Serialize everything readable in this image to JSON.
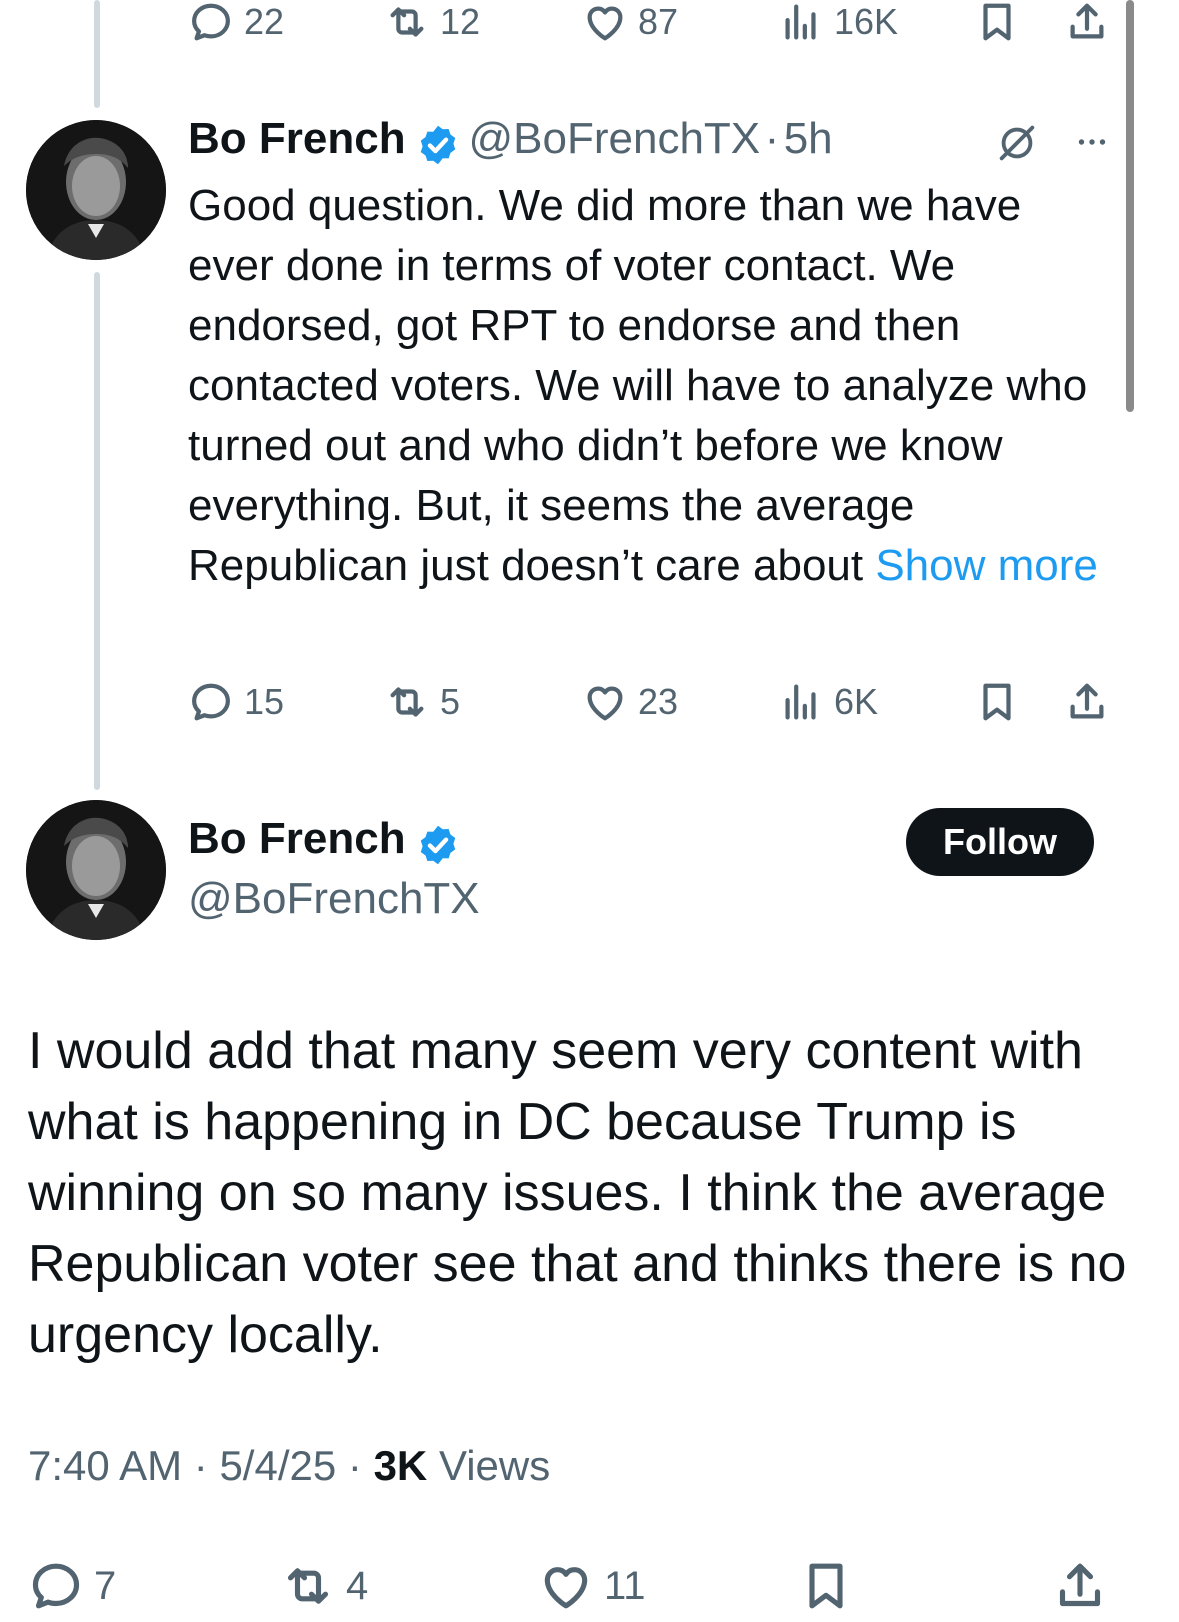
{
  "top_actions": {
    "replies": "22",
    "reposts": "12",
    "likes": "87",
    "views": "16K"
  },
  "reply_tweet": {
    "author_name": "Bo French",
    "handle": "@BoFrenchTX",
    "separator": "·",
    "time": "5h",
    "text": "Good question. We did more than we have ever done in terms of voter contact. We endorsed, got RPT to endorse and then contacted voters. We will have to analyze who turned out and who didn’t before we know everything. But, it seems the average Republican just doesn’t care about ",
    "show_more": "Show more",
    "actions": {
      "replies": "15",
      "reposts": "5",
      "likes": "23",
      "views": "6K"
    }
  },
  "main_tweet": {
    "author_name": "Bo French",
    "handle": "@BoFrenchTX",
    "follow_label": "Follow",
    "text": "I would add that many seem very content with what is happening in DC because Trump is winning on so many issues. I think the average Republican voter see that and thinks there is no urgency locally.",
    "time": "7:40 AM",
    "date": "5/4/25",
    "separator": "·",
    "views_count": "3K",
    "views_label": "Views",
    "actions": {
      "replies": "7",
      "reposts": "4",
      "likes": "11"
    }
  },
  "colors": {
    "accent": "#1d9bf0",
    "text": "#0f1419",
    "muted": "#536471",
    "thread_line": "#cfd9de"
  },
  "icons": [
    "reply-icon",
    "repost-icon",
    "like-icon",
    "views-icon",
    "bookmark-icon",
    "share-icon",
    "verified-badge-icon",
    "grok-icon",
    "more-icon"
  ]
}
